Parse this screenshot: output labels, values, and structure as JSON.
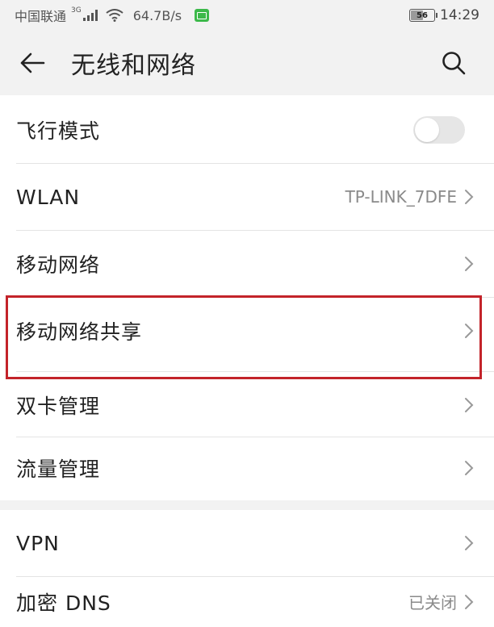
{
  "status_bar": {
    "carrier": "中国联通",
    "network_type": "3G",
    "speed": "64.7B/s",
    "battery": "56",
    "time": "14:29"
  },
  "header": {
    "title": "无线和网络",
    "back_icon": "arrow-left-icon",
    "search_icon": "search-icon"
  },
  "settings": {
    "airplane": {
      "label": "飞行模式",
      "enabled": false
    },
    "wlan": {
      "label": "WLAN",
      "value": "TP-LINK_7DFE"
    },
    "mobile_network": {
      "label": "移动网络"
    },
    "tethering": {
      "label": "移动网络共享"
    },
    "dual_sim": {
      "label": "双卡管理"
    },
    "data_usage": {
      "label": "流量管理"
    },
    "vpn": {
      "label": "VPN"
    },
    "private_dns": {
      "label": "加密 DNS",
      "value": "已关闭"
    }
  },
  "colors": {
    "highlight": "#c3232a",
    "app_badge": "#3cb94a",
    "background": "#f2f2f2"
  }
}
